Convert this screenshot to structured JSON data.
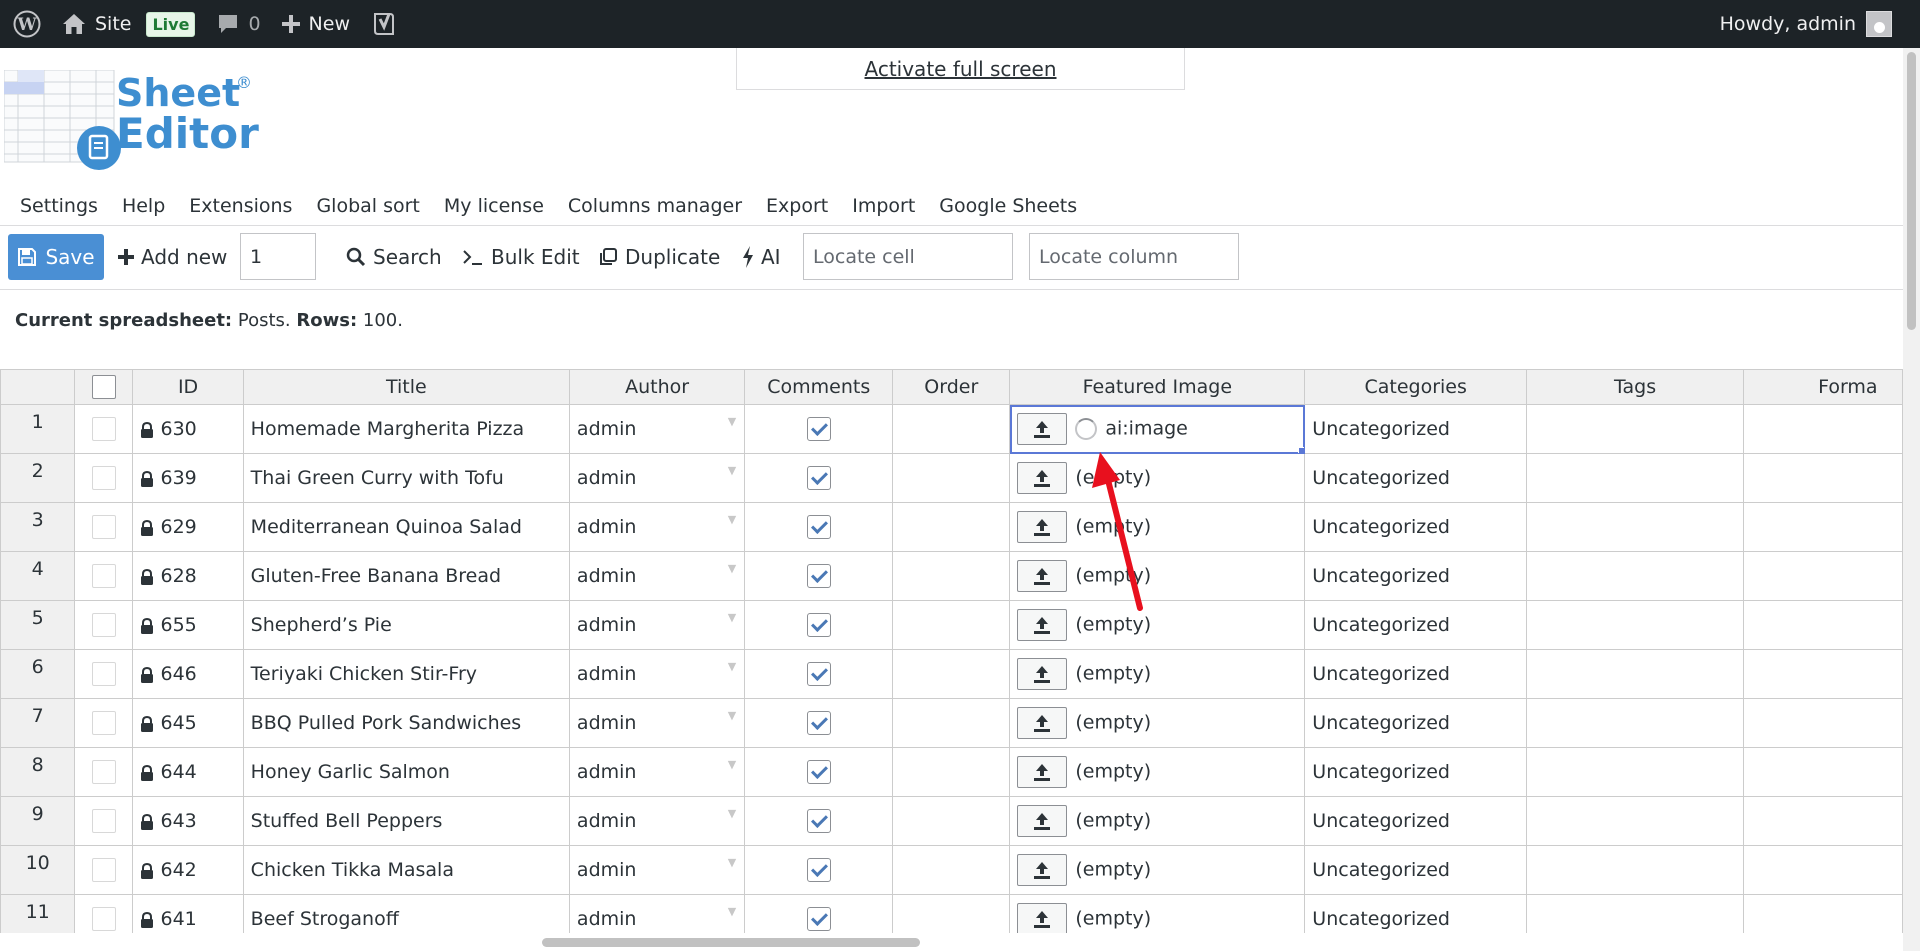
{
  "admin_bar": {
    "site_label": "Site",
    "live_badge": "Live",
    "comments_count": "0",
    "new_label": "New",
    "howdy": "Howdy, admin"
  },
  "fullscreen": {
    "link": "Activate full screen"
  },
  "logo": {
    "line1": "Sheet",
    "line2": "Editor",
    "reg": "®"
  },
  "menu": [
    "Settings",
    "Help",
    "Extensions",
    "Global sort",
    "My license",
    "Columns manager",
    "Export",
    "Import",
    "Google Sheets"
  ],
  "toolbar": {
    "save": "Save",
    "add_new": "Add new",
    "add_count": "1",
    "search": "Search",
    "bulk_edit": "Bulk Edit",
    "duplicate": "Duplicate",
    "ai": "AI",
    "locate_cell_placeholder": "Locate cell",
    "locate_column_placeholder": "Locate column"
  },
  "sheet_info": {
    "label_spreadsheet": "Current spreadsheet:",
    "spreadsheet": "Posts.",
    "label_rows": "Rows:",
    "rows": "100."
  },
  "columns": [
    "ID",
    "Title",
    "Author",
    "Comments",
    "Order",
    "Featured Image",
    "Categories",
    "Tags",
    "Forma"
  ],
  "rows": [
    {
      "n": "1",
      "id": "630",
      "title": "Homemade Margherita Pizza",
      "author": "admin",
      "image": "ai:image",
      "category": "Uncategorized"
    },
    {
      "n": "2",
      "id": "639",
      "title": "Thai Green Curry with Tofu",
      "author": "admin",
      "image": "(empty)",
      "category": "Uncategorized"
    },
    {
      "n": "3",
      "id": "629",
      "title": "Mediterranean Quinoa Salad",
      "author": "admin",
      "image": "(empty)",
      "category": "Uncategorized"
    },
    {
      "n": "4",
      "id": "628",
      "title": "Gluten-Free Banana Bread",
      "author": "admin",
      "image": "(empty)",
      "category": "Uncategorized"
    },
    {
      "n": "5",
      "id": "655",
      "title": "Shepherd’s Pie",
      "author": "admin",
      "image": "(empty)",
      "category": "Uncategorized"
    },
    {
      "n": "6",
      "id": "646",
      "title": "Teriyaki Chicken Stir-Fry",
      "author": "admin",
      "image": "(empty)",
      "category": "Uncategorized"
    },
    {
      "n": "7",
      "id": "645",
      "title": "BBQ Pulled Pork Sandwiches",
      "author": "admin",
      "image": "(empty)",
      "category": "Uncategorized"
    },
    {
      "n": "8",
      "id": "644",
      "title": "Honey Garlic Salmon",
      "author": "admin",
      "image": "(empty)",
      "category": "Uncategorized"
    },
    {
      "n": "9",
      "id": "643",
      "title": "Stuffed Bell Peppers",
      "author": "admin",
      "image": "(empty)",
      "category": "Uncategorized"
    },
    {
      "n": "10",
      "id": "642",
      "title": "Chicken Tikka Masala",
      "author": "admin",
      "image": "(empty)",
      "category": "Uncategorized"
    },
    {
      "n": "11",
      "id": "641",
      "title": "Beef Stroganoff",
      "author": "admin",
      "image": "(empty)",
      "category": "Uncategorized"
    }
  ]
}
